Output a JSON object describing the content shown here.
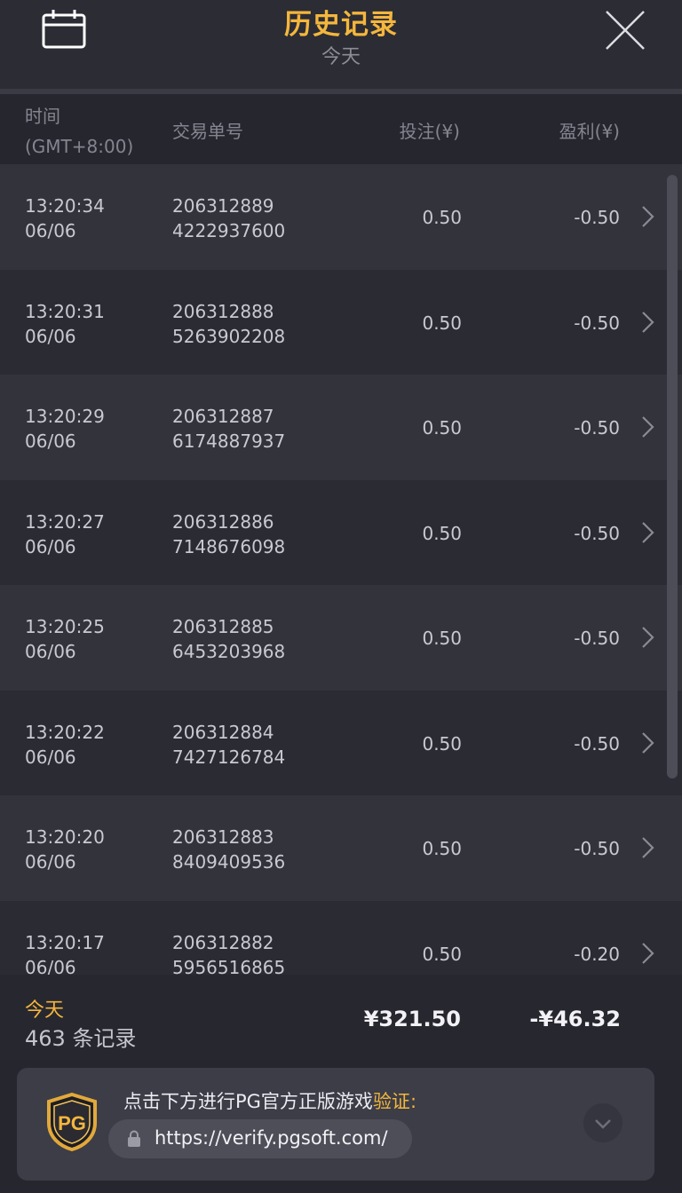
{
  "header": {
    "title": "历史记录",
    "subtitle": "今天",
    "calendar_icon": "calendar-icon",
    "close_icon": "close-icon"
  },
  "columns": {
    "time_label": "时间",
    "time_zone": "(GMT+8:00)",
    "tx_label": "交易单号",
    "bet_label": "投注(¥)",
    "pl_label": "盈利(¥)"
  },
  "rows": [
    {
      "time": "13:20:34",
      "date": "06/06",
      "tx1": "206312889",
      "tx2": "4222937600",
      "bet": "0.50",
      "pl": "-0.50"
    },
    {
      "time": "13:20:31",
      "date": "06/06",
      "tx1": "206312888",
      "tx2": "5263902208",
      "bet": "0.50",
      "pl": "-0.50"
    },
    {
      "time": "13:20:29",
      "date": "06/06",
      "tx1": "206312887",
      "tx2": "6174887937",
      "bet": "0.50",
      "pl": "-0.50"
    },
    {
      "time": "13:20:27",
      "date": "06/06",
      "tx1": "206312886",
      "tx2": "7148676098",
      "bet": "0.50",
      "pl": "-0.50"
    },
    {
      "time": "13:20:25",
      "date": "06/06",
      "tx1": "206312885",
      "tx2": "6453203968",
      "bet": "0.50",
      "pl": "-0.50"
    },
    {
      "time": "13:20:22",
      "date": "06/06",
      "tx1": "206312884",
      "tx2": "7427126784",
      "bet": "0.50",
      "pl": "-0.50"
    },
    {
      "time": "13:20:20",
      "date": "06/06",
      "tx1": "206312883",
      "tx2": "8409409536",
      "bet": "0.50",
      "pl": "-0.50"
    },
    {
      "time": "13:20:17",
      "date": "06/06",
      "tx1": "206312882",
      "tx2": "5956516865",
      "bet": "0.50",
      "pl": "-0.20"
    }
  ],
  "summary": {
    "label": "今天",
    "count": "463 条记录",
    "total_bet": "¥321.50",
    "total_pl": "-¥46.32"
  },
  "verify": {
    "prompt": "点击下方进行PG官方正版游戏",
    "prompt_highlight": "验证",
    "prompt_colon": ":",
    "logo_text": "PG",
    "url": "https://verify.pgsoft.com/"
  },
  "colors": {
    "accent": "#f4b63d",
    "background": "#26262f",
    "row_odd": "#32333b",
    "row_even": "#2a2b33"
  }
}
